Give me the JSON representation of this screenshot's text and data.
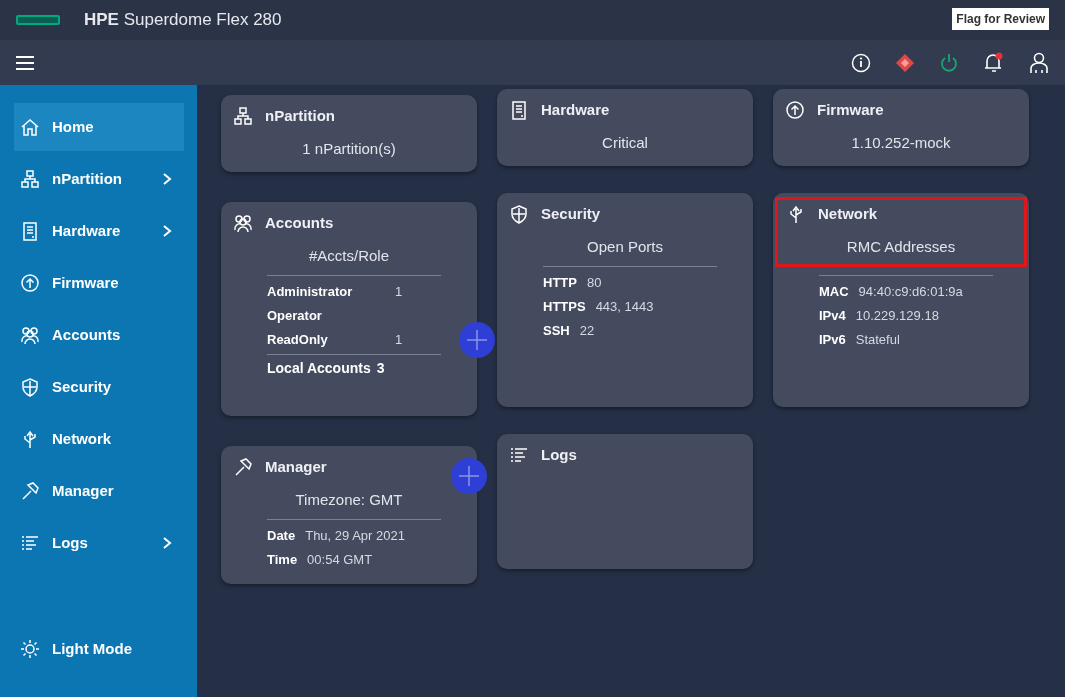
{
  "header": {
    "title": "**HPE** Superdome Flex 280",
    "flag_label": "Flag for Review"
  },
  "sidebar": {
    "items": [
      {
        "label": "Home",
        "has_submenu": false,
        "selected": true
      },
      {
        "label": "nPartition",
        "has_submenu": true,
        "selected": false
      },
      {
        "label": "Hardware",
        "has_submenu": true,
        "selected": false
      },
      {
        "label": "Firmware",
        "has_submenu": false,
        "selected": false
      },
      {
        "label": "Accounts",
        "has_submenu": false,
        "selected": false
      },
      {
        "label": "Security",
        "has_submenu": false,
        "selected": false
      },
      {
        "label": "Network",
        "has_submenu": false,
        "selected": false
      },
      {
        "label": "Manager",
        "has_submenu": false,
        "selected": false
      },
      {
        "label": "Logs",
        "has_submenu": true,
        "selected": false
      }
    ],
    "footer": "Light Mode"
  },
  "columns": [
    [
      {
        "title": "nPartition",
        "summary": "1 nPartition(s)"
      },
      {
        "title": "Accounts",
        "summary": "#Accts/Role",
        "rows": [
          {
            "label": "Administrator",
            "value": "1"
          },
          {
            "label": "Operator"
          },
          {
            "label": "ReadOnly",
            "value": "1"
          }
        ],
        "footer": {
          "label": "Local Accounts",
          "value": "3"
        },
        "add_handle": true
      },
      {
        "title": "Manager",
        "summary": "Timezone: GMT",
        "rows": [
          {
            "label": "Date",
            "value": "Thu, 29 Apr 2021"
          },
          {
            "label": "Time",
            "value": "00:54 GMT"
          }
        ],
        "add_handle": true
      }
    ],
    [
      {
        "title": "Hardware",
        "summary": "Critical"
      },
      {
        "title": "Security",
        "summary": "Open Ports",
        "rows": [
          {
            "label": "HTTP",
            "value": "80"
          },
          {
            "label": "HTTPS",
            "value": "443, 1443"
          },
          {
            "label": "SSH",
            "value": "22"
          }
        ]
      },
      {
        "title": "Logs"
      }
    ],
    [
      {
        "title": "Firmware",
        "summary": "1.10.252-mock"
      },
      {
        "title": "Network",
        "summary": "RMC Addresses",
        "highlighted": true,
        "rows": [
          {
            "label": "MAC",
            "value": "94:40:c9:d6:01:9a"
          },
          {
            "label": "IPv4",
            "value": "10.229.129.18"
          },
          {
            "label": "IPv6",
            "value": "Stateful"
          }
        ]
      }
    ]
  ]
}
